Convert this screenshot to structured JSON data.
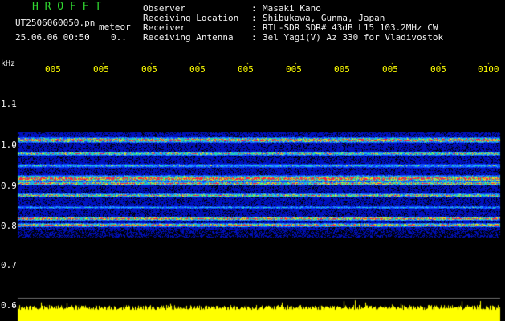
{
  "header": {
    "brand": "H R O F F T",
    "filename": "UT2506060050.pn",
    "meteor_label": "meteor",
    "datetime": "25.06.06 00:50",
    "count": "0.."
  },
  "info": {
    "rows": [
      {
        "label": "Observer",
        "sep": ":",
        "value": "Masaki Kano"
      },
      {
        "label": "Receiving Location",
        "sep": ":",
        "value": "Shibukawa, Gunma, Japan"
      },
      {
        "label": "Receiver",
        "sep": ":",
        "value": "RTL-SDR SDR# 43dB L15 103.2MHz CW"
      },
      {
        "label": "Receiving Antenna",
        "sep": ":",
        "value": "3el Yagi(V) Az 330 for Vladivostok"
      }
    ]
  },
  "axis": {
    "y_unit": "kHz",
    "y_ticks": [
      "1.1",
      "1.0",
      "0.9",
      "0.8",
      "0.7",
      "0.6"
    ],
    "x_ticks": [
      "005",
      "005",
      "005",
      "005",
      "005",
      "005",
      "005",
      "005",
      "005",
      "0100"
    ]
  },
  "colors": {
    "band_strong": "#ff2040",
    "band_medium": "#20e0a0",
    "noise_blue": "#0010c0",
    "baseline": "#ffff00",
    "text_green": "#30d830",
    "text_white": "#f0f0f0",
    "text_yellow": "#ffff00"
  }
}
